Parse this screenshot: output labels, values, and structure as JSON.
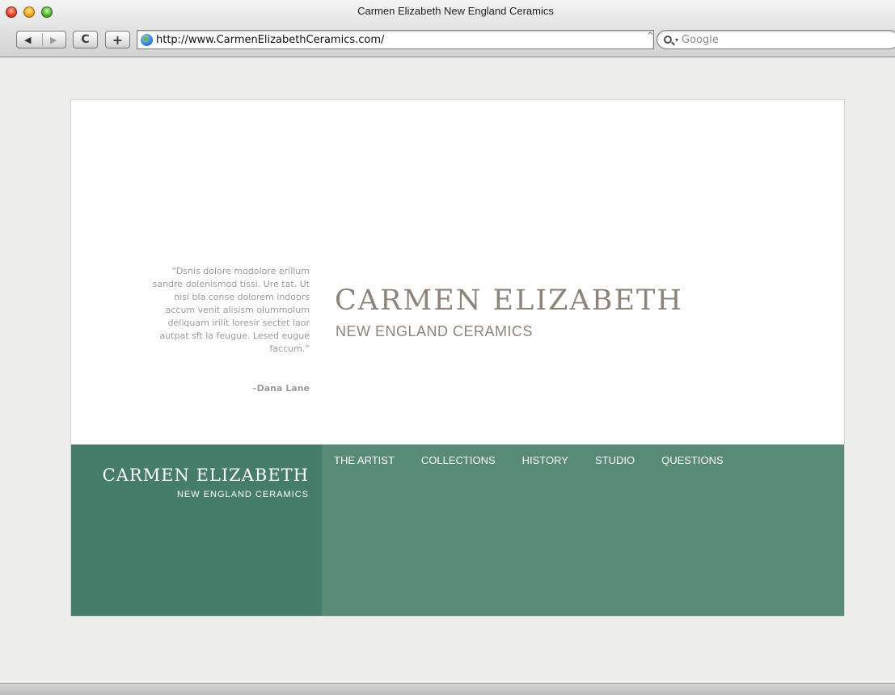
{
  "browser": {
    "window_title": "Carmen Elizabeth New England Ceramics",
    "url": "http://www.CarmenElizabethCeramics.com/",
    "search_placeholder": "Google",
    "reload_glyph": "C",
    "add_glyph": "+",
    "back_glyph": "◀",
    "forward_glyph": "▶",
    "url_caret_glyph": "^",
    "search_menu_glyph": "▾"
  },
  "hero": {
    "quote": "“Dsnis dolore modolore erillum sandre dolenismod tissi. Ure tat. Ut nisi bla conse dolorem indoors accum venit alisism olummolum deliquam irilit loresir sectet laor autpat sft la feugue. Lesed eugue faccum.”",
    "quote_author": "–Dana Lane",
    "title": "CARMEN ELIZABETH",
    "subtitle": "NEW ENGLAND CERAMICS"
  },
  "footer": {
    "brand_title": "CARMEN ELIZABETH",
    "brand_subtitle": "NEW ENGLAND CERAMICS",
    "nav": [
      {
        "label": "THE ARTIST"
      },
      {
        "label": "COLLECTIONS"
      },
      {
        "label": "HISTORY"
      },
      {
        "label": "STUDIO"
      },
      {
        "label": "QUESTIONS"
      }
    ]
  },
  "colors": {
    "brand_green": "#457c6a",
    "nav_green": "#588a78",
    "title_taupe": "#8e8378",
    "quote_gray": "#9b9b95",
    "page_background": "#ededeb"
  }
}
